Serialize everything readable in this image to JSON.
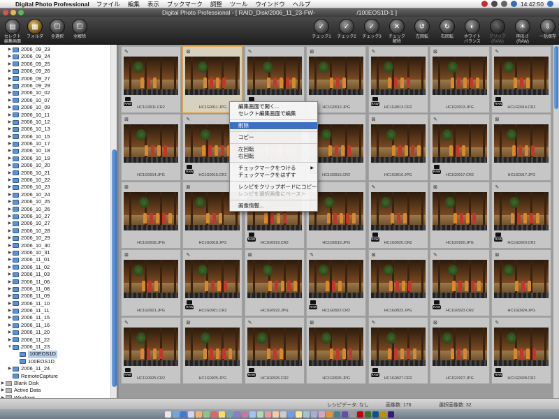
{
  "menubar": {
    "app_name": "Digital Photo Professional",
    "items": [
      "ファイル",
      "編集",
      "表示",
      "ブックマーク",
      "調整",
      "ツール",
      "ウインドウ",
      "ヘルプ"
    ],
    "clock": "14:42:50"
  },
  "window": {
    "title": "Digital Photo Professional - [ RAID_Disk/2006_11_23-FW-　　　　　　　/100EOS1D-1 ]"
  },
  "toolbar": {
    "left_buttons": [
      {
        "label": "セレクト\n編集画面",
        "icon": "select-edit-icon"
      },
      {
        "label": "フォルダ",
        "icon": "folder-icon"
      },
      {
        "label": "全選択",
        "icon": "select-all-icon"
      },
      {
        "label": "全解除",
        "icon": "deselect-all-icon"
      }
    ],
    "right_buttons": [
      {
        "label": "チェック1",
        "icon": "check1-icon"
      },
      {
        "label": "チェック2",
        "icon": "check2-icon"
      },
      {
        "label": "チェック3",
        "icon": "check3-icon"
      },
      {
        "label": "チェック\n解除",
        "icon": "check-clear-icon"
      },
      {
        "label": "左回転",
        "icon": "rotate-left-icon"
      },
      {
        "label": "右回転",
        "icon": "rotate-right-icon"
      },
      {
        "label": "ホワイト\nバランス",
        "icon": "white-balance-icon"
      },
      {
        "label": "クリック\n(RAW)",
        "icon": "click-raw-icon"
      },
      {
        "label": "明るさ\n(RAW)",
        "icon": "brightness-raw-icon"
      },
      {
        "label": "一括保存",
        "icon": "batch-save-icon"
      }
    ]
  },
  "tree": {
    "folders": [
      "2006_09_23",
      "2006_09_24",
      "2006_09_25",
      "2006_09_26",
      "2006_09_27",
      "2006_09_29",
      "2006_10_02",
      "2006_10_07",
      "2006_10_09",
      "2006_10_11",
      "2006_10_12",
      "2006_10_13",
      "2006_10_15",
      "2006_10_17",
      "2006_10_18",
      "2006_10_19",
      "2006_10_20",
      "2006_10_21",
      "2006_10_22",
      "2006_10_23",
      "2006_10_24",
      "2006_10_25",
      "2006_10_26",
      "2006_10_27",
      "2006_10_27",
      "2006_10_28",
      "2006_10_29",
      "2006_10_30",
      "2006_10_31",
      "2006_11_01",
      "2006_11_02",
      "2006_11_03",
      "2006_11_06",
      "2006_11_08",
      "2006_11_09",
      "2006_11_10",
      "2006_11_11",
      "2006_11_15",
      "2006_11_16",
      "2006_11_20",
      "2006_11_22",
      "2006_11_23"
    ],
    "subfolders": [
      "100EOS1D",
      "100EOS1D"
    ],
    "after": [
      "2006_11_24",
      "RemoteCapture"
    ],
    "drives": [
      "Blank Disk",
      "Active Data",
      "Windows"
    ]
  },
  "thumbnails": [
    {
      "name": "HC1G0911.CR2",
      "raw": true
    },
    {
      "name": "HC1G0911.JPG",
      "raw": false
    },
    {
      "name": "HC1G0912.CR2",
      "raw": true
    },
    {
      "name": "HC1G0912.JPG",
      "raw": false
    },
    {
      "name": "HC1G0913.CR2",
      "raw": true
    },
    {
      "name": "HC1G0913.JPG",
      "raw": false
    },
    {
      "name": "HC1G0914.CR2",
      "raw": true
    },
    {
      "name": "HC1G0914.JPG",
      "raw": false
    },
    {
      "name": "HC1G0915.CR2",
      "raw": true
    },
    {
      "name": "HC1G0915.JPG",
      "raw": false
    },
    {
      "name": "HC1G0916.CR2",
      "raw": true
    },
    {
      "name": "HC1G0916.JPG",
      "raw": false
    },
    {
      "name": "HC1G0917.CR2",
      "raw": true
    },
    {
      "name": "HC1G0917.JPG",
      "raw": false
    },
    {
      "name": "HC1G0918.JPG",
      "raw": false
    },
    {
      "name": "HC1G0918.JPG",
      "raw": false
    },
    {
      "name": "HC1G0919.CR2",
      "raw": true
    },
    {
      "name": "HC1G0919.JPG",
      "raw": false
    },
    {
      "name": "HC1G0920.CR2",
      "raw": true
    },
    {
      "name": "HC1G0920.JPG",
      "raw": false
    },
    {
      "name": "HC1G0920.CR2",
      "raw": true
    },
    {
      "name": "HC1G0921.JPG",
      "raw": false
    },
    {
      "name": "HC1G0921.CR2",
      "raw": true
    },
    {
      "name": "HC1G0922.JPG",
      "raw": false
    },
    {
      "name": "HC1G0922.CR2",
      "raw": true
    },
    {
      "name": "HC1G0923.JPG",
      "raw": false
    },
    {
      "name": "HC1G0923.CR2",
      "raw": true
    },
    {
      "name": "HC1G0924.JPG",
      "raw": false
    },
    {
      "name": "HC1G0925.CR2",
      "raw": true
    },
    {
      "name": "HC1G0925.JPG",
      "raw": false
    },
    {
      "name": "HC1G0926.CR2",
      "raw": true
    },
    {
      "name": "HC1G0926.JPG",
      "raw": false
    },
    {
      "name": "HC1G0927.CR2",
      "raw": true
    },
    {
      "name": "HC1G0927.JPG",
      "raw": false
    },
    {
      "name": "HC1G0928.CR2",
      "raw": true
    }
  ],
  "context_menu": {
    "items": [
      {
        "label": "編集画面で開く...",
        "state": "normal"
      },
      {
        "label": "セレクト編集画面で編集",
        "state": "normal"
      },
      {
        "sep": true
      },
      {
        "label": "削除",
        "state": "highlight"
      },
      {
        "sep": true
      },
      {
        "label": "コピー",
        "state": "normal"
      },
      {
        "sep": true
      },
      {
        "label": "左回転",
        "state": "normal"
      },
      {
        "label": "右回転",
        "state": "normal"
      },
      {
        "sep": true
      },
      {
        "label": "チェックマークをつける",
        "state": "normal",
        "submenu": true
      },
      {
        "label": "チェックマークをはずす",
        "state": "normal"
      },
      {
        "sep": true
      },
      {
        "label": "レシピをクリップボードにコピー",
        "state": "normal"
      },
      {
        "label": "レシピを選択画像にペースト",
        "state": "disabled"
      },
      {
        "sep": true
      },
      {
        "label": "画像情報...",
        "state": "normal"
      }
    ]
  },
  "status": {
    "recipe": "レシピデータ: なし",
    "image_count": "画像数: 176",
    "selected_count": "選択画像数: 32"
  },
  "dock_colors": [
    "#e8e8e8",
    "#6fa8dc",
    "#3c78d8",
    "#d9d2e9",
    "#f6b26b",
    "#93c47d",
    "#e06666",
    "#ffd966",
    "#76a5af",
    "#8e7cc3",
    "#c27ba0",
    "#a4c2f4",
    "#b6d7a8",
    "#ea9999",
    "#f9cb9c",
    "#cccccc",
    "#6d9eeb",
    "#ffe599",
    "#a2c4c9",
    "#b4a7d6",
    "#d5a6bd",
    "#e69138",
    "#45818e",
    "#674ea7",
    "#999999",
    "#cc0000",
    "#38761d",
    "#0b5394",
    "#bf9000",
    "#351c75"
  ],
  "colors": {
    "selection_border": "#e8a23a",
    "menu_highlight": "#3d6fc4"
  }
}
